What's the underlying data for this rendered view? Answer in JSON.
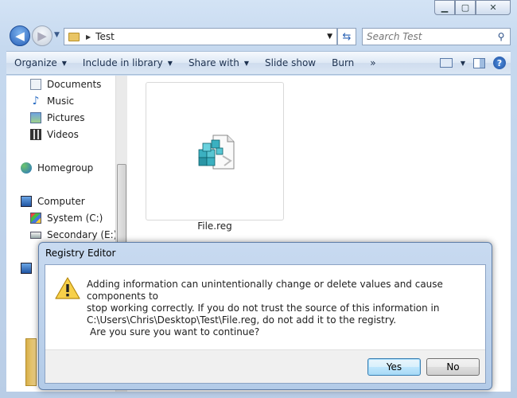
{
  "window": {
    "caption_buttons": {
      "minimize": "▁",
      "maximize": "▢",
      "close": "✕"
    }
  },
  "address_bar": {
    "path_label": "Test",
    "search_placeholder": "Search Test"
  },
  "command_bar": {
    "items": [
      {
        "label": "Organize",
        "dropdown": true
      },
      {
        "label": "Include in library",
        "dropdown": true
      },
      {
        "label": "Share with",
        "dropdown": true
      },
      {
        "label": "Slide show",
        "dropdown": false
      },
      {
        "label": "Burn",
        "dropdown": false
      },
      {
        "label": "»",
        "dropdown": false
      }
    ]
  },
  "navigation": {
    "items": [
      {
        "label": "Documents",
        "icon": "documents-icon"
      },
      {
        "label": "Music",
        "icon": "music-icon"
      },
      {
        "label": "Pictures",
        "icon": "pictures-icon"
      },
      {
        "label": "Videos",
        "icon": "videos-icon"
      },
      {
        "label": "Homegroup",
        "icon": "homegroup-icon"
      },
      {
        "label": "Computer",
        "icon": "computer-icon"
      },
      {
        "label": "System (C:)",
        "icon": "windows-drive-icon"
      },
      {
        "label": "Secondary (E:)",
        "icon": "drive-icon"
      }
    ]
  },
  "files": [
    {
      "name": "File.reg",
      "icon": "registry-file-icon"
    }
  ],
  "dialog": {
    "title": "Registry Editor",
    "message_line1": "Adding information can unintentionally change or delete values and cause components to",
    "message_line2": "stop working correctly. If you do not trust the source of this information in",
    "message_line3": "C:\\Users\\Chris\\Desktop\\Test\\File.reg, do not add it to the registry.",
    "confirm": "Are you sure you want to continue?",
    "yes_label": "Yes",
    "no_label": "No"
  }
}
